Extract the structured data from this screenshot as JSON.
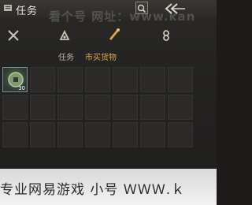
{
  "header": {
    "title": "任务",
    "watermark": "看个号  网址：www.kan"
  },
  "tabs": [
    {
      "id": "tab-swords",
      "label": ""
    },
    {
      "id": "tab-quest",
      "label": "任务"
    },
    {
      "id": "tab-market",
      "label": "市买货物"
    },
    {
      "id": "tab-other",
      "label": ""
    }
  ],
  "inventory": {
    "items": [
      {
        "name": "jade-coin",
        "quantity": "30"
      }
    ]
  },
  "footer": {
    "text": "专业网易游戏 小号 ＷＷＷ.ｋ"
  },
  "colors": {
    "active_tab": "#d8a64a",
    "text": "#e6e2d6"
  }
}
